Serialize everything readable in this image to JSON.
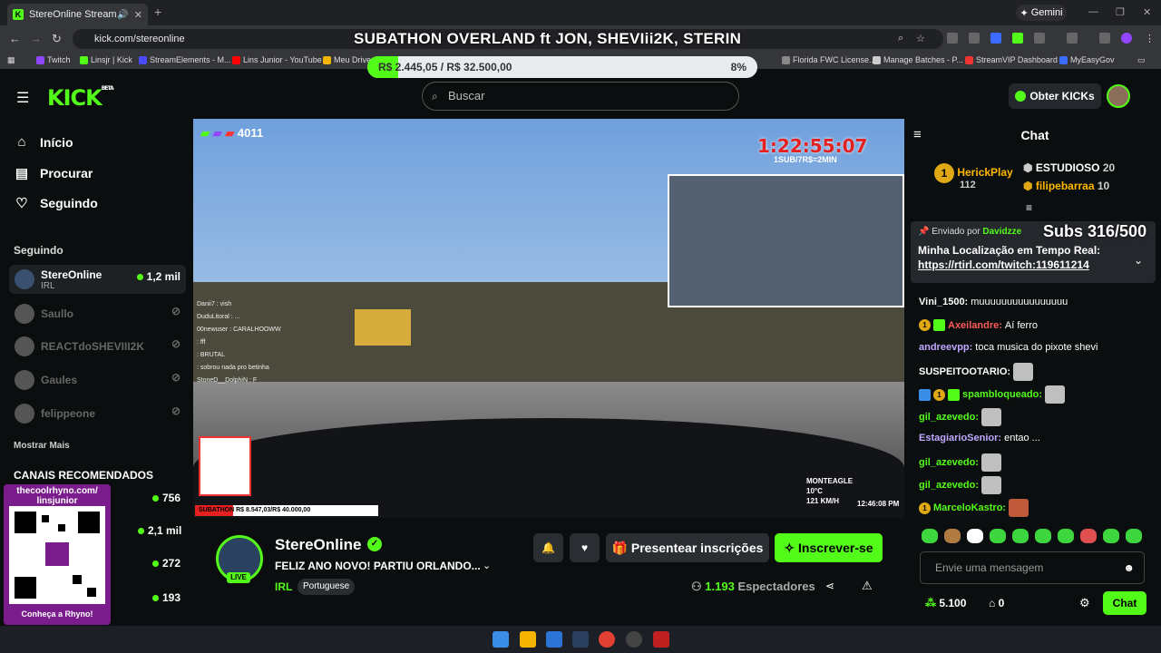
{
  "browser": {
    "tab_title": "StereOnline Stream - Watch",
    "url": "kick.com/stereonline",
    "gemini_label": "Gemini",
    "bookmarks": [
      "Twitch",
      "Linsjr | Kick",
      "StreamElements - M...",
      "Lins Junior - YouTube",
      "Meu Drive",
      "Florida FWC License...",
      "Manage Batches - P...",
      "StreamVIP Dashboard",
      "MyEasyGov"
    ]
  },
  "overlay": {
    "title": "SUBATHON OVERLAND ft JON, SHEVIii2K, STERIN",
    "goal_text": "R$ 2.445,05 / R$ 32.500,00",
    "goal_pct": "8%",
    "goal_fraction": 0.08
  },
  "header": {
    "logo": "KICK",
    "logo_badge": "BETA",
    "search_placeholder": "Buscar",
    "obter_label": "Obter KICKs"
  },
  "sidebar": {
    "nav": [
      {
        "label": "Início",
        "icon": "home-icon"
      },
      {
        "label": "Procurar",
        "icon": "browse-icon"
      },
      {
        "label": "Seguindo",
        "icon": "heart-icon"
      }
    ],
    "following_title": "Seguindo",
    "channels": [
      {
        "name": "StereOnline",
        "sub": "IRL",
        "viewers": "1,2 mil",
        "live": true
      },
      {
        "name": "Saullo",
        "live": false
      },
      {
        "name": "REACTdoSHEVIII2K",
        "live": false
      },
      {
        "name": "Gaules",
        "live": false
      },
      {
        "name": "felippeone",
        "live": false
      }
    ],
    "show_more": "Mostrar Mais",
    "recommended_title": "CANAIS RECOMENDADOS",
    "recommended_counts": [
      "756",
      "2,1 mil",
      "272",
      "193"
    ],
    "rhyno_top": "thecoolrhyno.com/ linsjunior",
    "rhyno_bottom": "Conheça a Rhyno!"
  },
  "video": {
    "viewer_counter": "4011",
    "timer": "1:22:55:07",
    "sub_rule": "1SUB/7R$=2MIN",
    "overlay_chat": [
      "Danii7 : vish",
      "DuduLitoral : ...",
      "00newuser : CARALHOOWW",
      ": fff",
      ": BRUTAL",
      ": sobrou nada pro betinha",
      "StoneD__DolphiN : F"
    ],
    "subathon_bar": "SUBATHON R$ 8.547,03/R$ 40.000,00",
    "subathon_fraction": 0.21,
    "weather_place": "MONTEAGLE",
    "weather_temp": "10°C",
    "speed": "121 KM/H",
    "clock": "12:46:08 PM"
  },
  "stream": {
    "channel": "StereOnline",
    "title": "FELIZ ANO NOVO! PARTIU ORLANDO...",
    "category": "IRL",
    "language": "Portuguese",
    "gift_label": "Presentear inscrições",
    "subscribe_label": "Inscrever-se",
    "viewers": "1.193",
    "viewers_label": "Espectadores",
    "live_label": "LIVE"
  },
  "chat": {
    "title": "Chat",
    "gifters": [
      {
        "name": "HerickPlay",
        "count": "112"
      },
      {
        "name": "ESTUDIOSO",
        "count": "20"
      },
      {
        "name": "filipebarraa",
        "count": "10"
      }
    ],
    "pinned_by_label": "Enviado por",
    "pinned_by": "Davidzze",
    "pinned_line1": "Minha Localização em Tempo Real:",
    "pinned_link": "https://rtirl.com/twitch:119611214",
    "subs_overlay": "Subs 316/500",
    "messages": [
      {
        "user": "Vini_1500:",
        "text": "muuuuuuuuuuuuuuuu",
        "color": "#ffffff"
      },
      {
        "user": "Axeilandre:",
        "text": "Aí ferro",
        "color": "#ff5a5a"
      },
      {
        "user": "andreevpp:",
        "text": "toca musica do pixote shevi",
        "color": "#c0a8ff"
      },
      {
        "user": "SUSPEITOOTARIO:",
        "text": "",
        "color": "#ffffff"
      },
      {
        "user": "spambloqueado:",
        "text": "",
        "color": "#53fc18"
      },
      {
        "user": "gil_azevedo:",
        "text": "",
        "color": "#53fc18"
      },
      {
        "user": "EstagiarioSenior:",
        "text": "entao ...",
        "color": "#c0a8ff"
      },
      {
        "user": "gil_azevedo:",
        "text": "",
        "color": "#53fc18"
      },
      {
        "user": "gil_azevedo:",
        "text": "",
        "color": "#53fc18"
      },
      {
        "user": "MarceloKastro:",
        "text": "",
        "color": "#53fc18"
      }
    ],
    "input_placeholder": "Envie uma mensagem",
    "points": "5.100",
    "store_count": "0",
    "send_label": "Chat"
  }
}
